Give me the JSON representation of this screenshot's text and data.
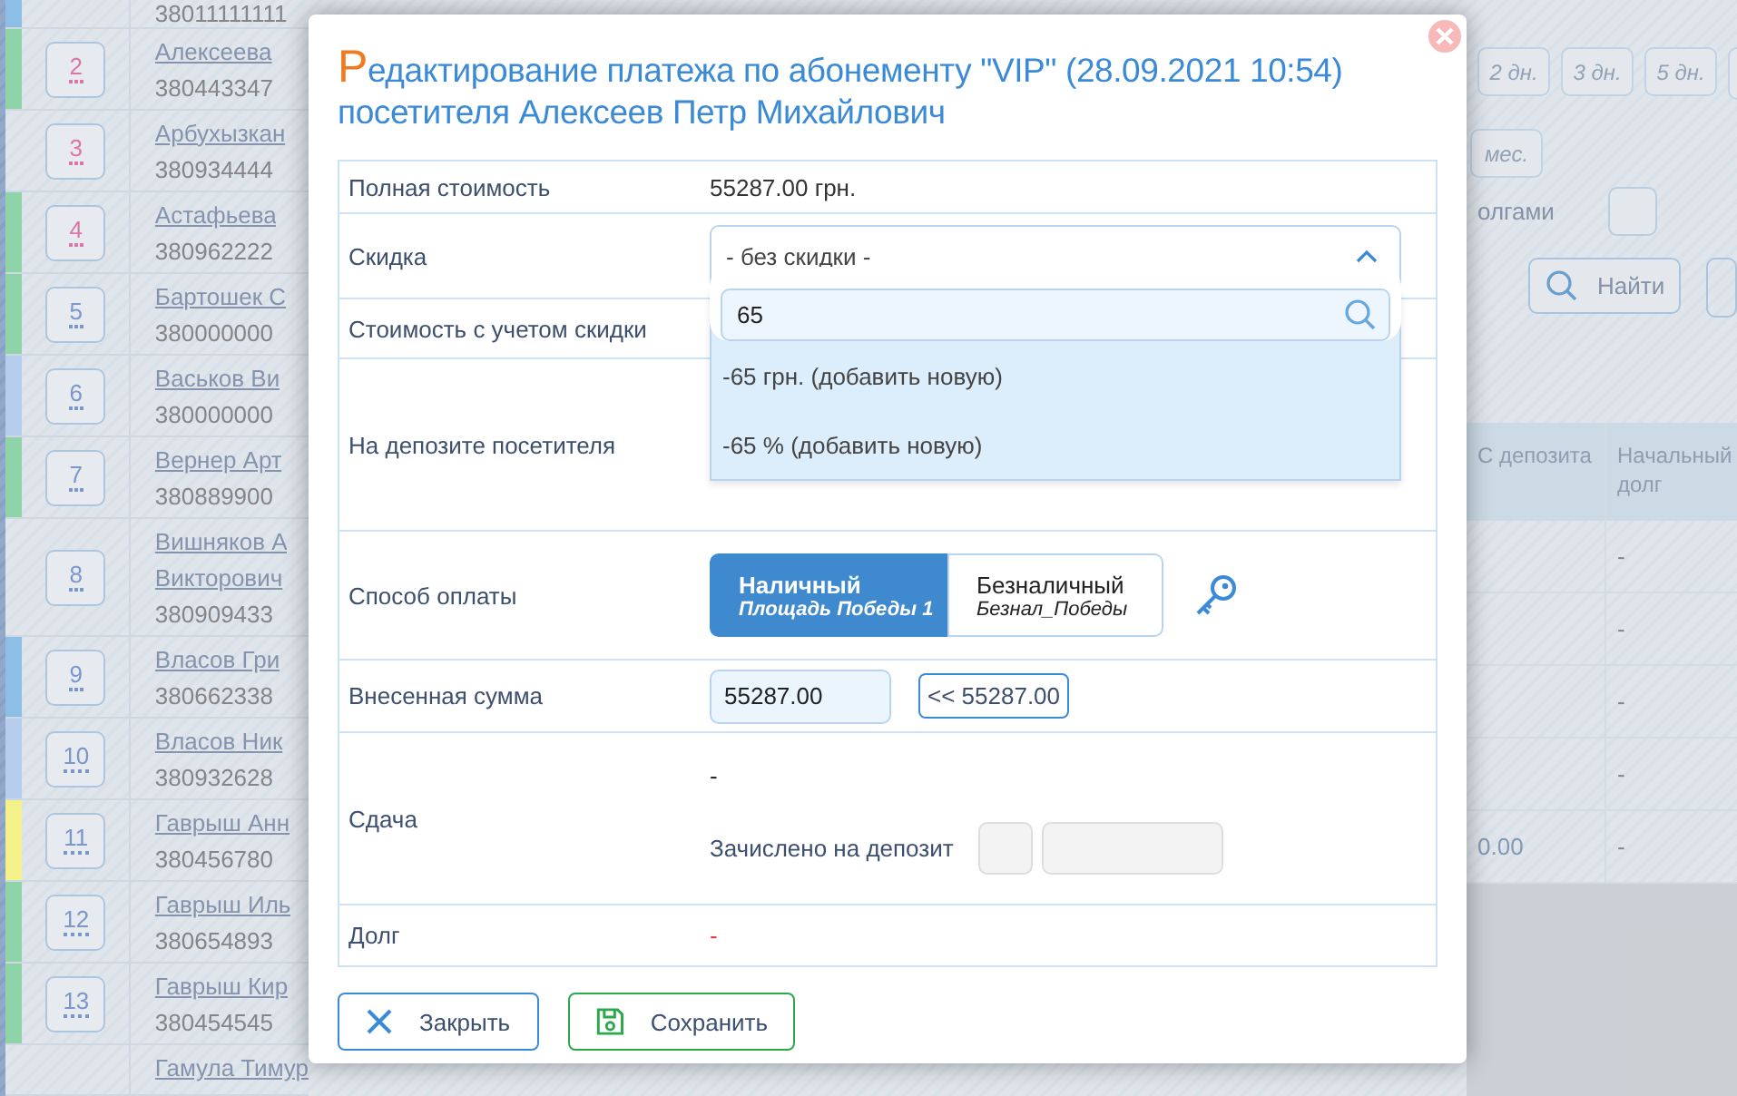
{
  "members": [
    {
      "phone": "38011111111",
      "color": "#8dbfe6"
    },
    {
      "number": "2",
      "highlight": true,
      "name": [
        "Алексеева"
      ],
      "phone": "380443347",
      "color": "#8ed4a8"
    },
    {
      "number": "3",
      "highlight": true,
      "name": [
        "Арбухызкан"
      ],
      "phone": "380934444"
    },
    {
      "number": "4",
      "highlight": true,
      "name": [
        "Астафьева"
      ],
      "phone": "380962222",
      "color": "#8ed4a8"
    },
    {
      "number": "5",
      "highlight": false,
      "name": [
        "Бартошек С"
      ],
      "phone": "380000000",
      "color": "#8ed4a8"
    },
    {
      "number": "6",
      "highlight": false,
      "name": [
        "Васьков Ви"
      ],
      "phone": "380000000",
      "color": "#b6cdee"
    },
    {
      "number": "7",
      "highlight": false,
      "name": [
        "Вернер Арт"
      ],
      "phone": "380889900",
      "color": "#8ed4a8"
    },
    {
      "number": "8",
      "highlight": false,
      "name": [
        "Вишняков А",
        "Викторович"
      ],
      "phone": "380909433"
    },
    {
      "number": "9",
      "highlight": false,
      "name": [
        "Власов Гри"
      ],
      "phone": "380662338",
      "color": "#8dbfe6"
    },
    {
      "number": "10",
      "highlight": false,
      "name": [
        "Власов Ник"
      ],
      "phone": "380932628",
      "color": "#b6cdee"
    },
    {
      "number": "11",
      "highlight": false,
      "name": [
        "Гаврыш Анн"
      ],
      "phone": "380456780",
      "color": "#f4f08a"
    },
    {
      "number": "12",
      "highlight": false,
      "name": [
        "Гаврыш Иль"
      ],
      "phone": "380654893",
      "color": "#8ed4a8"
    },
    {
      "number": "13",
      "highlight": false,
      "name": [
        "Гаврыш Кир"
      ],
      "phone": "380454545",
      "color": "#8ed4a8"
    },
    {
      "name": [
        "Гамула Тимур"
      ]
    }
  ],
  "filters": {
    "periods": [
      "2 дн.",
      "3 дн.",
      "5 дн."
    ],
    "month": "мес.",
    "debt_label": "олгами",
    "debt_checked": false,
    "find_button": "Найти"
  },
  "table": {
    "columns": [
      "С депозита",
      "Начальный долг"
    ],
    "rows": [
      {
        "initial_debt": "-"
      },
      {
        "initial_debt": "-"
      },
      {
        "initial_debt": "-"
      },
      {
        "initial_debt": "-"
      },
      {
        "from_deposit": "0.00",
        "initial_debt": "-"
      }
    ]
  },
  "dialog": {
    "title_initial": "Р",
    "title": "едактирование платежа по абонементу \"VIP\" (28.09.2021 10:54) посетителя Алексеев Петр Михайлович",
    "rows": [
      {
        "kind": "text",
        "label": "Полная стоимость",
        "value": "55287.00 грн."
      },
      {
        "kind": "select",
        "label": "Скидка",
        "value": "- без скидки -",
        "expanded": true,
        "search": "65",
        "options": [
          "-65 грн. (добавить новую)",
          "-65 % (добавить новую)"
        ]
      },
      {
        "kind": "blank",
        "label": "Стоимость с учетом скидки"
      },
      {
        "kind": "blank",
        "label": "На депозите посетителя"
      },
      {
        "kind": "payment",
        "label": "Способ оплаты",
        "methods": [
          {
            "title": "Наличный",
            "subtitle": "Площадь Победы 1",
            "selected": true
          },
          {
            "title": "Безналичный",
            "subtitle": "Безнал_Победы",
            "selected": false
          }
        ]
      },
      {
        "kind": "amount",
        "label": "Внесенная сумма",
        "value": "55287.00",
        "fill_button": "<< 55287.00"
      },
      {
        "kind": "change",
        "label": "Сдача",
        "value": "-",
        "deposit_label": "Зачислено на депозит",
        "deposit_checked": false
      },
      {
        "kind": "debt",
        "label": "Долг",
        "value": "-"
      }
    ],
    "buttons": [
      {
        "kind": "close",
        "label": "Закрыть"
      },
      {
        "kind": "save",
        "label": "Сохранить"
      }
    ]
  }
}
